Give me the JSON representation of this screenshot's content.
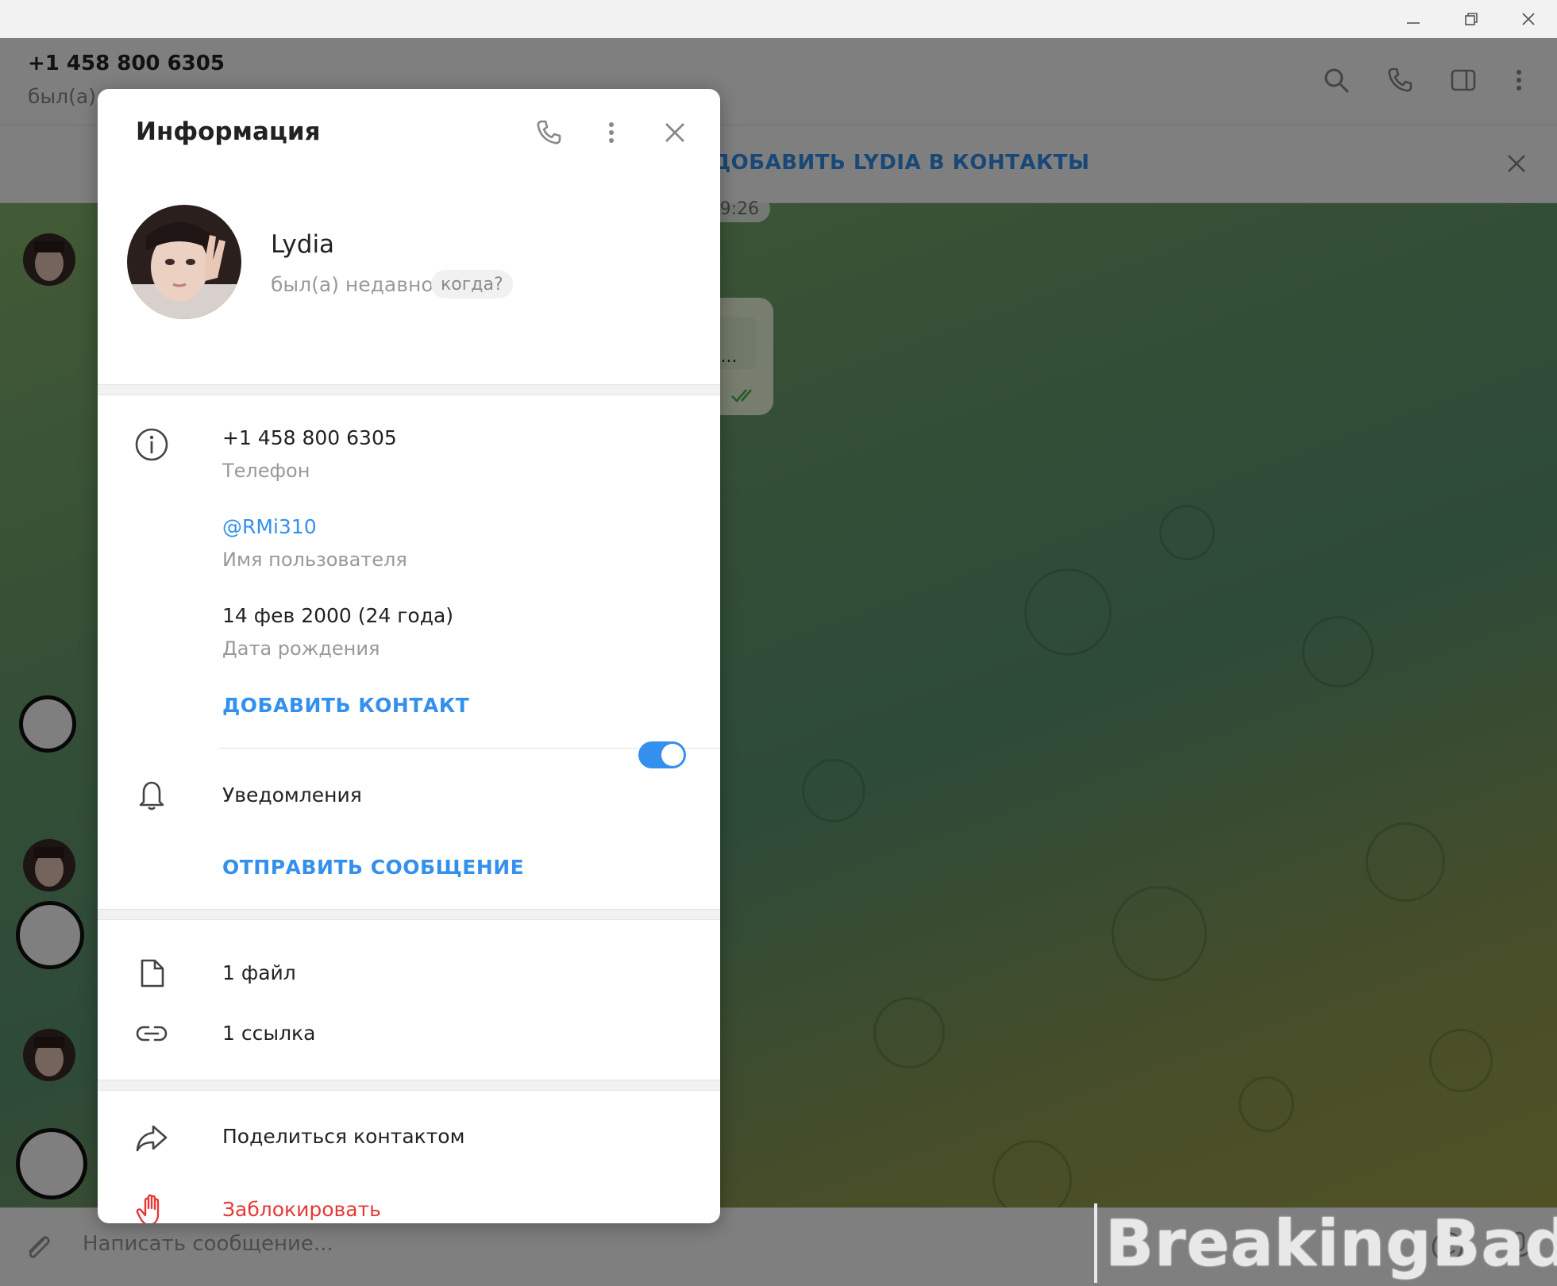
{
  "window": {
    "minimize_icon": "minimize-icon",
    "restore_icon": "restore-icon",
    "close_icon": "close-icon"
  },
  "chat": {
    "title": "+1 458 800 6305",
    "status": "был(а)",
    "add_contact_bar": "ДОБАВИТЬ LYDIA В КОНТАКТЫ",
    "date_pill": "9:26",
    "message_preview": "е...",
    "composer_placeholder": "Написать сообщение..."
  },
  "watermark": {
    "text": "BreakingBad"
  },
  "modal": {
    "title": "Информация",
    "profile": {
      "name": "Lydia",
      "status": "был(а) недавно",
      "when_label": "когда?"
    },
    "info": {
      "phone_value": "+1 458 800 6305",
      "phone_label": "Телефон",
      "username_value": "@RMi310",
      "username_label": "Имя пользователя",
      "birthday_value": "14 фев 2000 (24 года)",
      "birthday_label": "Дата рождения",
      "add_contact": "ДОБАВИТЬ КОНТАКТ"
    },
    "notifications": {
      "label": "Уведомления",
      "enabled": true,
      "send_message": "ОТПРАВИТЬ СООБЩЕНИЕ"
    },
    "media": {
      "files": "1 файл",
      "links": "1 ссылка"
    },
    "actions": {
      "share": "Поделиться контактом",
      "block": "Заблокировать"
    }
  },
  "colors": {
    "accent": "#3390ec",
    "danger": "#e53935",
    "toggle_on": "#3390ec"
  }
}
